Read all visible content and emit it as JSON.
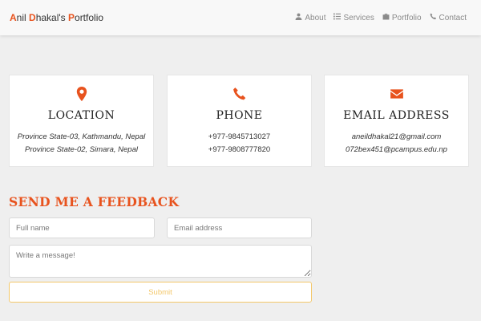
{
  "brand": {
    "first_initial": "A",
    "first_rest": "nil ",
    "last_initial": "D",
    "last_rest": "hakal's ",
    "third_initial": "P",
    "third_rest": "ortfolio"
  },
  "nav": [
    {
      "label": "About",
      "icon": "user-icon"
    },
    {
      "label": "Services",
      "icon": "list-icon"
    },
    {
      "label": "Portfolio",
      "icon": "briefcase-icon"
    },
    {
      "label": "Contact",
      "icon": "phone-icon"
    }
  ],
  "cards": [
    {
      "icon": "map-marker-icon",
      "title": "LOCATION",
      "lines": [
        "Province State-03, Kathmandu, Nepal",
        "Province State-02, Simara, Nepal"
      ]
    },
    {
      "icon": "phone-icon",
      "title": "PHONE",
      "lines": [
        "+977-9845713027",
        "+977-9808777820"
      ]
    },
    {
      "icon": "envelope-icon",
      "title": "EMAIL ADDRESS",
      "lines": [
        "aneildhakal21@gmail.com",
        "072bex451@pcampus.edu.np"
      ]
    }
  ],
  "feedback": {
    "title": "SEND ME A FEEDBACK",
    "name_placeholder": "Full name",
    "email_placeholder": "Email address",
    "message_placeholder": "Write a message!",
    "submit_label": "Submit"
  },
  "colors": {
    "accent": "#e8531e",
    "submit": "#f3c76a",
    "background": "#efefef"
  }
}
